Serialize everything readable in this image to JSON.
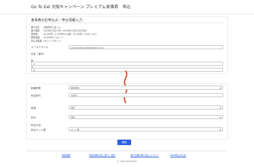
{
  "header": {
    "title": "Go To Eat 大阪キャンペーン プレミアム食事券　申込"
  },
  "form": {
    "section_title": "食事券のお申込み｜申込情報入力",
    "info": [
      {
        "label": "発行会社",
        "value": "大阪府商工会 ○○"
      },
      {
        "label": "発行期間",
        "value": "2020年10月19日〜2020年12月25日(予定)"
      },
      {
        "label": "発券額",
        "value": "10,000円（1,000円×10枚）12,500円（×25）(×2)"
      },
      {
        "label": "購買価格",
        "value": "10,000円 / 1セット"
      },
      {
        "label": "申込可能数",
        "value": "2セット＊3セット"
      }
    ],
    "email": {
      "label": "メールアドレス",
      "value": "sample.sahara@gotoeat.co.jp"
    },
    "name_label": "氏名（漢字）",
    "last_name": {
      "label": "姓",
      "value": "山"
    },
    "first_name": {
      "label": "名",
      "value": "太"
    },
    "prefecture": {
      "label": "都道府県",
      "value": "都道府県"
    },
    "city": {
      "label": "市区町村",
      "value": "大阪市"
    },
    "gender": {
      "label": "性別",
      "value": "選択"
    },
    "age": {
      "label": "年代",
      "value": "選択"
    },
    "apply_label": "申込方法",
    "quantity": {
      "label": "申込セット数",
      "value": "セット数"
    }
  },
  "submit_label": "確認",
  "footer": {
    "links": [
      "利用規約",
      "特定商取引法に基づく表示",
      "個人情報の取り扱いについて",
      "Web申込み方法"
    ],
    "copyright": "© 2020 GOTOEAT"
  }
}
